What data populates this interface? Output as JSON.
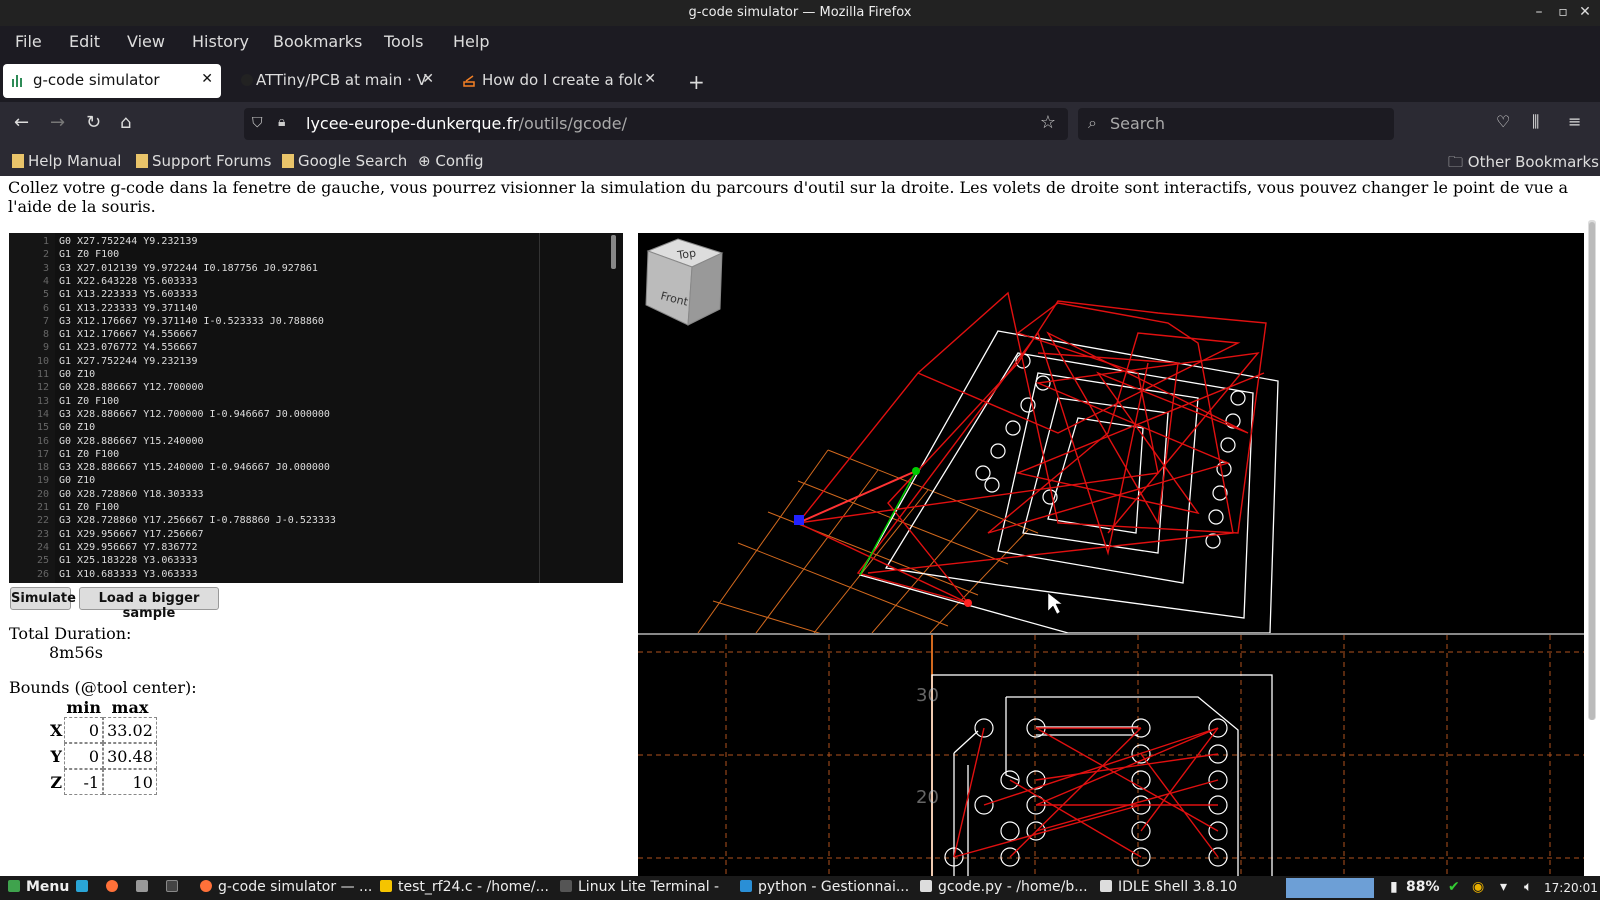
{
  "window": {
    "title": "g-code simulator — Mozilla Firefox"
  },
  "menu": [
    "File",
    "Edit",
    "View",
    "History",
    "Bookmarks",
    "Tools",
    "Help"
  ],
  "tabs": [
    {
      "label": "g-code simulator",
      "active": true
    },
    {
      "label": "ATTiny/PCB at main · V",
      "active": false
    },
    {
      "label": "How do I create a folder",
      "active": false
    }
  ],
  "address": {
    "host": "lycee-europe-dunkerque.fr",
    "path": "/outils/gcode/"
  },
  "search": {
    "placeholder": "Search"
  },
  "bookmarks": [
    "Help Manual",
    "Support Forums",
    "Google Search",
    "Config"
  ],
  "other_bookmarks": "Other Bookmarks",
  "intro": "Collez votre g-code dans la fenetre de gauche, vous pourrez visionner la simulation du parcours d'outil sur la droite. Les volets de droite sont interactifs, vous pouvez changer le point de vue a l'aide de la souris.",
  "gcode_lines": [
    "G0 X27.752244 Y9.232139",
    "G1 Z0 F100",
    "G3 X27.012139 Y9.972244 I0.187756 J0.927861",
    "G1 X22.643228 Y5.603333",
    "G1 X13.223333 Y5.603333",
    "G1 X13.223333 Y9.371140",
    "G3 X12.176667 Y9.371140 I-0.523333 J0.788860",
    "G1 X12.176667 Y4.556667",
    "G1 X23.076772 Y4.556667",
    "G1 X27.752244 Y9.232139",
    "G0 Z10",
    "G0 X28.886667 Y12.700000",
    "G1 Z0 F100",
    "G3 X28.886667 Y12.700000 I-0.946667 J0.000000",
    "G0 Z10",
    "G0 X28.886667 Y15.240000",
    "G1 Z0 F100",
    "G3 X28.886667 Y15.240000 I-0.946667 J0.000000",
    "G0 Z10",
    "G0 X28.728860 Y18.303333",
    "G1 Z0 F100",
    "G3 X28.728860 Y17.256667 I-0.788860 J-0.523333",
    "G1 X29.956667 Y17.256667",
    "G1 X29.956667 Y7.836772",
    "G1 X25.183228 Y3.063333",
    "G1 X10.683333 Y3.063333"
  ],
  "buttons": {
    "simulate": "Simulate",
    "load_sample": "Load a bigger sample"
  },
  "duration": {
    "label": "Total Duration:",
    "value": "8m56s"
  },
  "bounds": {
    "label": "Bounds (@tool center):",
    "headers": [
      "min",
      "max"
    ],
    "rows": [
      {
        "axis": "X",
        "min": "0",
        "max": "33.02"
      },
      {
        "axis": "Y",
        "min": "0",
        "max": "30.48"
      },
      {
        "axis": "Z",
        "min": "-1",
        "max": "10"
      }
    ]
  },
  "viewcube": {
    "top": "Top",
    "front": "Front"
  },
  "grid_labels": [
    "30",
    "20"
  ],
  "taskbar": {
    "menu": "Menu",
    "items": [
      "g-code simulator — ...",
      "test_rf24.c - /home/...",
      "Linux Lite Terminal -",
      "python - Gestionnai...",
      "gcode.py - /home/b...",
      "IDLE Shell 3.8.10"
    ],
    "battery": "88%",
    "clock": "17:20:01"
  },
  "colors": {
    "toolpath": "#e01010",
    "outline": "#ffffff",
    "grid": "#d2691e",
    "browser_chrome": "#1c1b22"
  }
}
